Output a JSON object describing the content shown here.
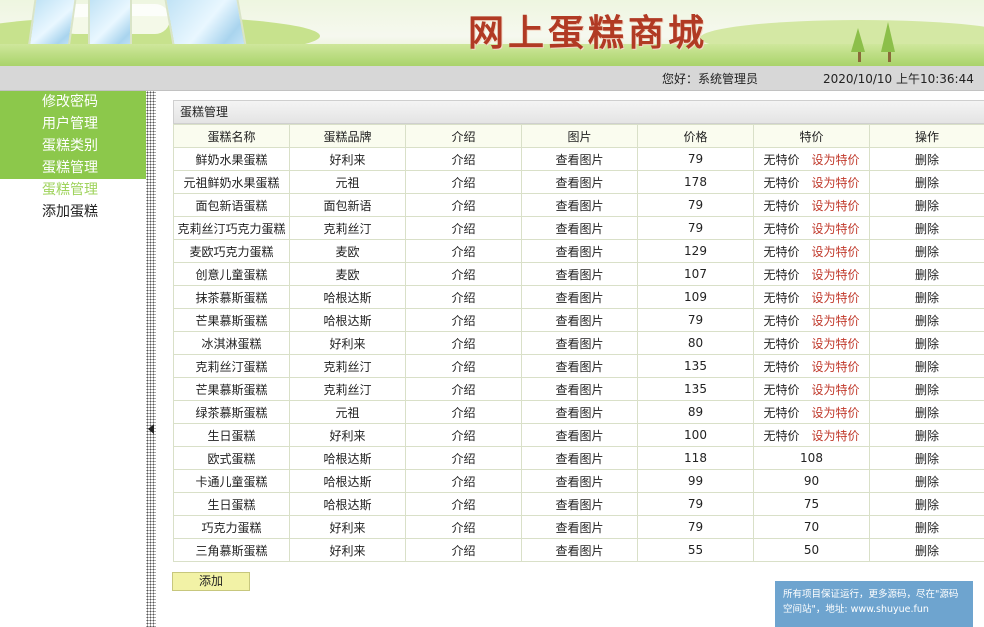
{
  "header": {
    "site_title": "网上蛋糕商城"
  },
  "userbar": {
    "greeting": "您好：系统管理员",
    "datetime": "2020/10/10 上午10:36:44"
  },
  "sidebar": {
    "items": [
      {
        "label": "修改密码"
      },
      {
        "label": "用户管理"
      },
      {
        "label": "蛋糕类别"
      },
      {
        "label": "蛋糕管理"
      },
      {
        "label": "蛋糕管理"
      },
      {
        "label": "添加蛋糕"
      }
    ]
  },
  "panel": {
    "title": "蛋糕管理",
    "columns": [
      "蛋糕名称",
      "蛋糕品牌",
      "介绍",
      "图片",
      "价格",
      "特价",
      "操作"
    ],
    "intro_link": "介绍",
    "image_link": "查看图片",
    "delete_link": "删除",
    "no_special": "无特价",
    "set_special": "设为特价",
    "rows": [
      {
        "name": "鲜奶水果蛋糕",
        "brand": "好利来",
        "price": "79",
        "special": ""
      },
      {
        "name": "元祖鲜奶水果蛋糕",
        "brand": "元祖",
        "price": "178",
        "special": ""
      },
      {
        "name": "面包新语蛋糕",
        "brand": "面包新语",
        "price": "79",
        "special": ""
      },
      {
        "name": "克莉丝汀巧克力蛋糕",
        "brand": "克莉丝汀",
        "price": "79",
        "special": ""
      },
      {
        "name": "麦欧巧克力蛋糕",
        "brand": "麦欧",
        "price": "129",
        "special": ""
      },
      {
        "name": "创意儿童蛋糕",
        "brand": "麦欧",
        "price": "107",
        "special": ""
      },
      {
        "name": "抹茶慕斯蛋糕",
        "brand": "哈根达斯",
        "price": "109",
        "special": ""
      },
      {
        "name": "芒果慕斯蛋糕",
        "brand": "哈根达斯",
        "price": "79",
        "special": ""
      },
      {
        "name": "冰淇淋蛋糕",
        "brand": "好利来",
        "price": "80",
        "special": ""
      },
      {
        "name": "克莉丝汀蛋糕",
        "brand": "克莉丝汀",
        "price": "135",
        "special": ""
      },
      {
        "name": "芒果慕斯蛋糕",
        "brand": "克莉丝汀",
        "price": "135",
        "special": ""
      },
      {
        "name": "绿茶慕斯蛋糕",
        "brand": "元祖",
        "price": "89",
        "special": ""
      },
      {
        "name": "生日蛋糕",
        "brand": "好利来",
        "price": "100",
        "special": ""
      },
      {
        "name": "欧式蛋糕",
        "brand": "哈根达斯",
        "price": "118",
        "special": "108"
      },
      {
        "name": "卡通儿童蛋糕",
        "brand": "哈根达斯",
        "price": "99",
        "special": "90"
      },
      {
        "name": "生日蛋糕",
        "brand": "哈根达斯",
        "price": "79",
        "special": "75"
      },
      {
        "name": "巧克力蛋糕",
        "brand": "好利来",
        "price": "79",
        "special": "70"
      },
      {
        "name": "三角慕斯蛋糕",
        "brand": "好利来",
        "price": "55",
        "special": "50"
      }
    ]
  },
  "add_button": "添加",
  "watermark": {
    "line1": "所有项目保证运行，更多源码，尽在\"源码",
    "line2": "空间站\"，地址: www.shuyue.fun"
  },
  "colors": {
    "menu_green": "#8cc84b",
    "title_red": "#b13a24",
    "special_red": "#c0392b",
    "add_button_bg": "#f2f2a6",
    "watermark_bg": "#6ea4cf"
  }
}
